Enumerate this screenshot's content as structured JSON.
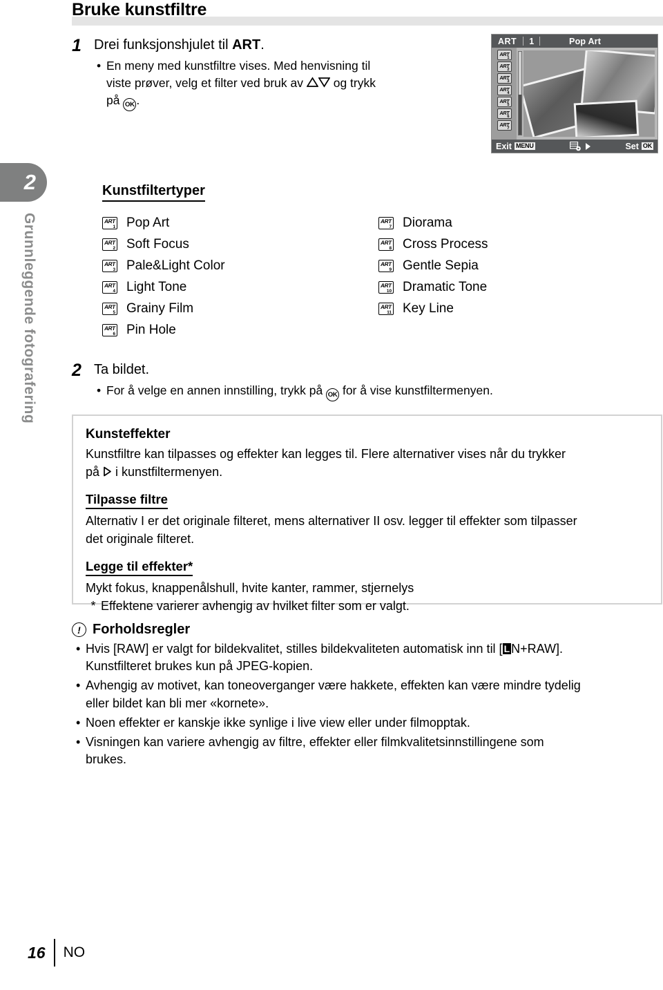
{
  "page": {
    "title": "Bruke kunstfiltre",
    "chapter_number": "2",
    "chapter_title": "Grunnleggende fotografering",
    "footer_page": "16",
    "footer_lang": "NO"
  },
  "steps": [
    {
      "number": "1",
      "title_pre": "Drei funksjonshjulet til ",
      "title_bold": "ART",
      "title_post": ".",
      "bullet_line1": "En meny med kunstfiltre vises. Med henvisning til",
      "bullet_line2_pre": "viste prøver, velg et filter ved bruk av ",
      "bullet_line2_post": " og trykk",
      "bullet_line3_pre": "på ",
      "bullet_line3_post": "."
    },
    {
      "number": "2",
      "title": "Ta bildet.",
      "bullet_pre": "For å velge en annen innstilling, trykk på ",
      "bullet_post": " for å vise kunstfiltermenyen."
    }
  ],
  "lcd": {
    "mode": "ART",
    "index": "1",
    "filter_name": "Pop Art",
    "exit_label": "Exit",
    "exit_key": "MENU",
    "set_label": "Set",
    "set_key": "OK",
    "rail_items": [
      {
        "art": "ART",
        "num": "1"
      },
      {
        "art": "ART",
        "num": "2"
      },
      {
        "art": "ART",
        "num": "3"
      },
      {
        "art": "ART",
        "num": "4"
      },
      {
        "art": "ART",
        "num": "5"
      },
      {
        "art": "ART",
        "num": "6"
      },
      {
        "art": "ART",
        "num": "7"
      }
    ]
  },
  "filter_types": {
    "heading": "Kunstfiltertyper",
    "left_column": [
      {
        "art": "ART",
        "num": "1",
        "label": "Pop Art"
      },
      {
        "art": "ART",
        "num": "2",
        "label": "Soft Focus"
      },
      {
        "art": "ART",
        "num": "3",
        "label": "Pale&Light Color"
      },
      {
        "art": "ART",
        "num": "4",
        "label": "Light Tone"
      },
      {
        "art": "ART",
        "num": "5",
        "label": "Grainy Film"
      },
      {
        "art": "ART",
        "num": "6",
        "label": "Pin Hole"
      }
    ],
    "right_column": [
      {
        "art": "ART",
        "num": "7",
        "label": "Diorama"
      },
      {
        "art": "ART",
        "num": "8",
        "label": "Cross Process"
      },
      {
        "art": "ART",
        "num": "9",
        "label": "Gentle Sepia"
      },
      {
        "art": "ART",
        "num": "10",
        "label": "Dramatic Tone"
      },
      {
        "art": "ART",
        "num": "11",
        "label": "Key Line"
      }
    ]
  },
  "effects_box": {
    "heading": "Kunsteffekter",
    "intro_line1": "Kunstfiltre kan tilpasses og effekter kan legges til. Flere alternativer vises når du trykker",
    "intro_line2_pre": "på ",
    "intro_line2_post": " i kunstfiltermenyen.",
    "sub1_heading": "Tilpasse filtre",
    "sub1_line1": "Alternativ I er det originale filteret, mens alternativer II osv. legger til effekter som tilpasser",
    "sub1_line2": "det originale filteret.",
    "sub2_heading": "Legge til effekter*",
    "sub2_line1": "Mykt fokus, knappenålshull, hvite kanter, rammer, stjernelys",
    "sub2_star": "*",
    "sub2_note": "Effektene varierer avhengig av hvilket filter som er valgt."
  },
  "caution": {
    "heading": "Forholdsregler",
    "items": [
      {
        "line1_pre": "Hvis [RAW] er valgt for bildekvalitet, stilles bildekvaliteten automatisk inn til [",
        "line1_badge": "L",
        "line1_post": "N+RAW].",
        "line2": "Kunstfilteret brukes kun på JPEG-kopien."
      },
      {
        "line1": "Avhengig av motivet, kan toneoverganger være hakkete, effekten kan være mindre tydelig",
        "line2": "eller bildet kan bli mer «kornete»."
      },
      {
        "line1": "Noen effekter er kanskje ikke synlige i live view eller under filmopptak."
      },
      {
        "line1": "Visningen kan variere avhengig av filtre, effekter eller filmkvalitetsinnstillingene som",
        "line2": "brukes."
      }
    ]
  }
}
